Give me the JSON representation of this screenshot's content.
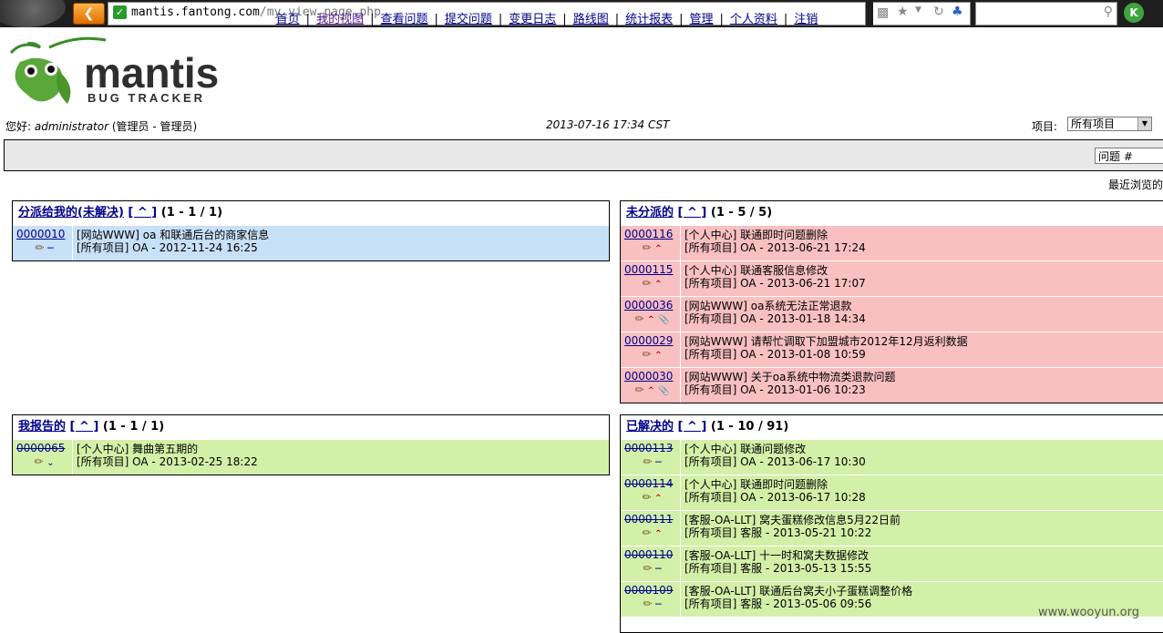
{
  "browser": {
    "url_host": "mantis.fantong.com",
    "url_path": "/my_view_page.php",
    "profile_badge": "K"
  },
  "logo": {
    "name": "mantis",
    "tagline": "BUG TRACKER"
  },
  "header": {
    "greeting_prefix": "您好:",
    "username": "administrator",
    "role": "(管理员 - 管理员)",
    "datetime": "2013-07-16 17:34 CST",
    "project_label": "项目:",
    "project_value": "所有项目"
  },
  "menu": {
    "items": [
      "首页",
      "我的视图",
      "查看问题",
      "提交问题",
      "变更日志",
      "路线图",
      "统计报表",
      "管理",
      "个人资料",
      "注销"
    ],
    "separator": "|",
    "bug_jump_value": "问题 #",
    "recent_label": "最近浏览的"
  },
  "boxes": {
    "assigned": {
      "title": "分派给我的(未解决)",
      "link": "[ ^ ]",
      "count": "(1 - 1 / 1)",
      "rows": [
        {
          "id": "0000010",
          "summary": "[网站WWW] oa 和联通后台的商家信息",
          "meta": "[所有项目] OA - 2012-11-24 16:25"
        }
      ]
    },
    "unassigned": {
      "title": "未分派的",
      "link": "[ ^ ]",
      "count": "(1 - 5 / 5)",
      "rows": [
        {
          "id": "0000116",
          "summary": "[个人中心] 联通即时问题删除",
          "meta": "[所有项目] OA - 2013-06-21 17:24"
        },
        {
          "id": "0000115",
          "summary": "[个人中心] 联通客服信息修改",
          "meta": "[所有项目] OA - 2013-06-21 17:07"
        },
        {
          "id": "0000036",
          "summary": "[网站WWW] oa系统无法正常退款",
          "meta": "[所有项目] OA - 2013-01-18 14:34"
        },
        {
          "id": "0000029",
          "summary": "[网站WWW] 请帮忙调取下加盟城市2012年12月返利数据",
          "meta": "[所有项目] OA - 2013-01-08 10:59"
        },
        {
          "id": "0000030",
          "summary": "[网站WWW] 关于oa系统中物流类退款问题",
          "meta": "[所有项目] OA - 2013-01-06 10:23"
        }
      ]
    },
    "reported": {
      "title": "我报告的",
      "link": "[ ^ ]",
      "count": "(1 - 1 / 1)",
      "rows": [
        {
          "id": "0000065",
          "summary": "[个人中心] 舞曲第五期的",
          "meta": "[所有项目] OA - 2013-02-25 18:22"
        }
      ]
    },
    "resolved": {
      "title": "已解决的",
      "link": "[ ^ ]",
      "count": "(1 - 10 / 91)",
      "rows": [
        {
          "id": "0000113",
          "summary": "[个人中心] 联通问题修改",
          "meta": "[所有项目] OA - 2013-06-17 10:30"
        },
        {
          "id": "0000114",
          "summary": "[个人中心] 联通即时问题删除",
          "meta": "[所有项目] OA - 2013-06-17 10:28"
        },
        {
          "id": "0000111",
          "summary": "[客服-OA-LLT] 窝夫蛋糕修改信息5月22日前",
          "meta": "[所有项目] 客服 - 2013-05-21 10:22"
        },
        {
          "id": "0000110",
          "summary": "[客服-OA-LLT] 十一时和窝夫数据修改",
          "meta": "[所有项目] 客服 - 2013-05-13 15:55"
        },
        {
          "id": "0000109",
          "summary": "[客服-OA-LLT] 联通后台窝夫小子蛋糕调整价格",
          "meta": "[所有项目] 客服 - 2013-05-06 09:56"
        }
      ]
    }
  },
  "watermark": "www.wooyun.org",
  "colors": {
    "assigned_bg": "#c8e0f8",
    "unassigned_bg": "#f8c0c0",
    "resolved_bg": "#d2f0a8",
    "menu_bg": "#e8e8e8",
    "link": "#00008b"
  }
}
